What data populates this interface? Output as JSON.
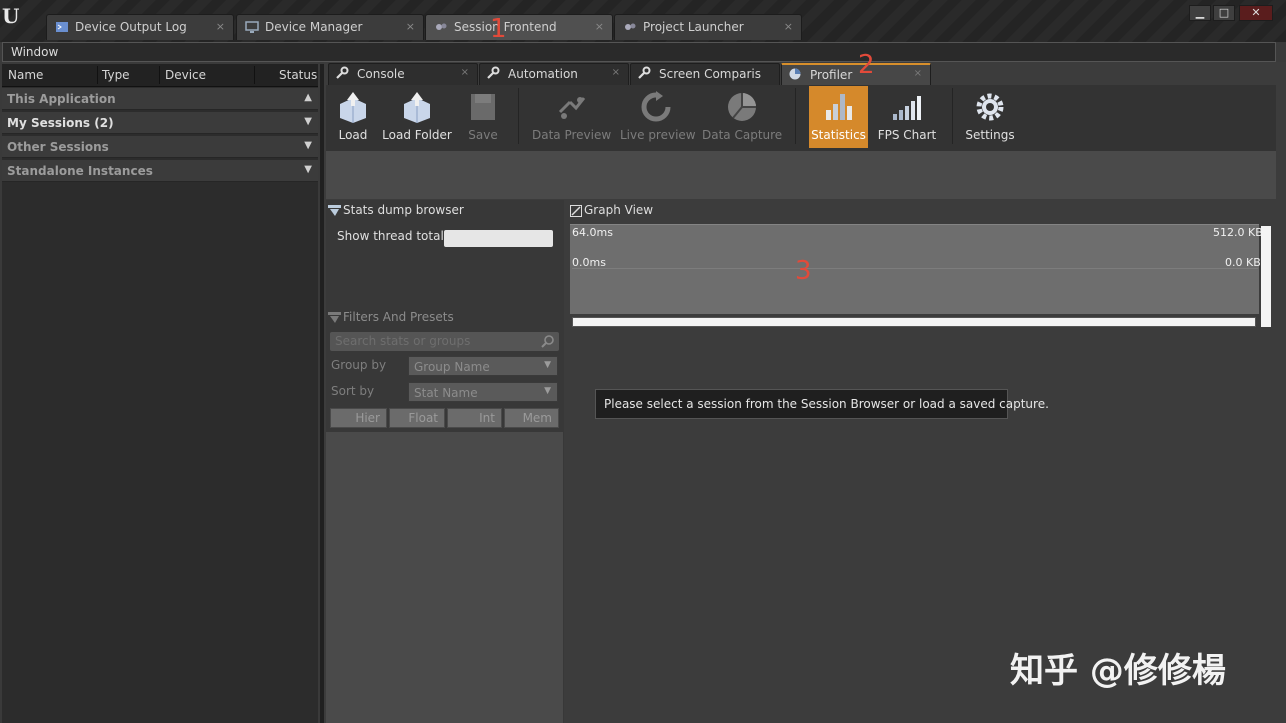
{
  "app": {
    "logo_text": "U"
  },
  "document_tabs": [
    {
      "label": "Device Output Log",
      "icon": "terminal-icon",
      "close": "×"
    },
    {
      "label": "Device Manager",
      "icon": "monitor-icon",
      "close": "×"
    },
    {
      "label": "Session Frontend",
      "icon": "session-icon",
      "close": "×"
    },
    {
      "label": "Project Launcher",
      "icon": "launcher-icon",
      "close": "×"
    }
  ],
  "window_controls": {
    "minimize": "▁",
    "maximize": "□",
    "close": "✕"
  },
  "menu": {
    "window": "Window"
  },
  "session_browser": {
    "columns": [
      "Name",
      "Type",
      "Device",
      "Status"
    ],
    "groups": [
      {
        "label": "This Application",
        "arrow": "▲"
      },
      {
        "label": "My Sessions (2)",
        "arrow": "▼"
      },
      {
        "label": "Other Sessions",
        "arrow": "▼"
      },
      {
        "label": "Standalone Instances",
        "arrow": "▼"
      }
    ]
  },
  "sub_tabs": [
    {
      "label": "Console",
      "icon": "wrench-icon",
      "close": "×"
    },
    {
      "label": "Automation",
      "icon": "wrench-icon",
      "close": "×"
    },
    {
      "label": "Screen Comparison",
      "icon": "wrench-icon",
      "close": ""
    },
    {
      "label": "Profiler",
      "icon": "profiler-icon",
      "close": "×"
    }
  ],
  "toolbar": {
    "load": "Load",
    "load_folder": "Load Folder",
    "save": "Save",
    "data_preview": "Data Preview",
    "live_preview": "Live preview",
    "data_capture": "Data Capture",
    "statistics": "Statistics",
    "fps_chart": "FPS Chart",
    "settings": "Settings"
  },
  "stats_browser": {
    "title": "Stats dump browser",
    "show_thread_totals": "Show thread totals f",
    "filters_title": "Filters And Presets",
    "search_placeholder": "Search stats or groups",
    "group_by_label": "Group by",
    "group_by_value": "Group Name",
    "sort_by_label": "Sort by",
    "sort_by_value": "Stat Name",
    "type_buttons": [
      "Hier",
      "Float",
      "Int",
      "Mem"
    ]
  },
  "graph_view": {
    "title": "Graph View",
    "left_top": "64.0ms",
    "left_mid": "0.0ms",
    "right_top": "512.0 KB",
    "right_mid": "0.0 KB"
  },
  "message": "Please select a session from the Session Browser or load a saved capture.",
  "annotations": {
    "one": "1",
    "two": "2",
    "three": "3"
  },
  "watermark": "知乎 @修修楊",
  "colors": {
    "accent": "#d5892b",
    "annotation": "#e24a3a",
    "panel": "#3c3c3c"
  }
}
